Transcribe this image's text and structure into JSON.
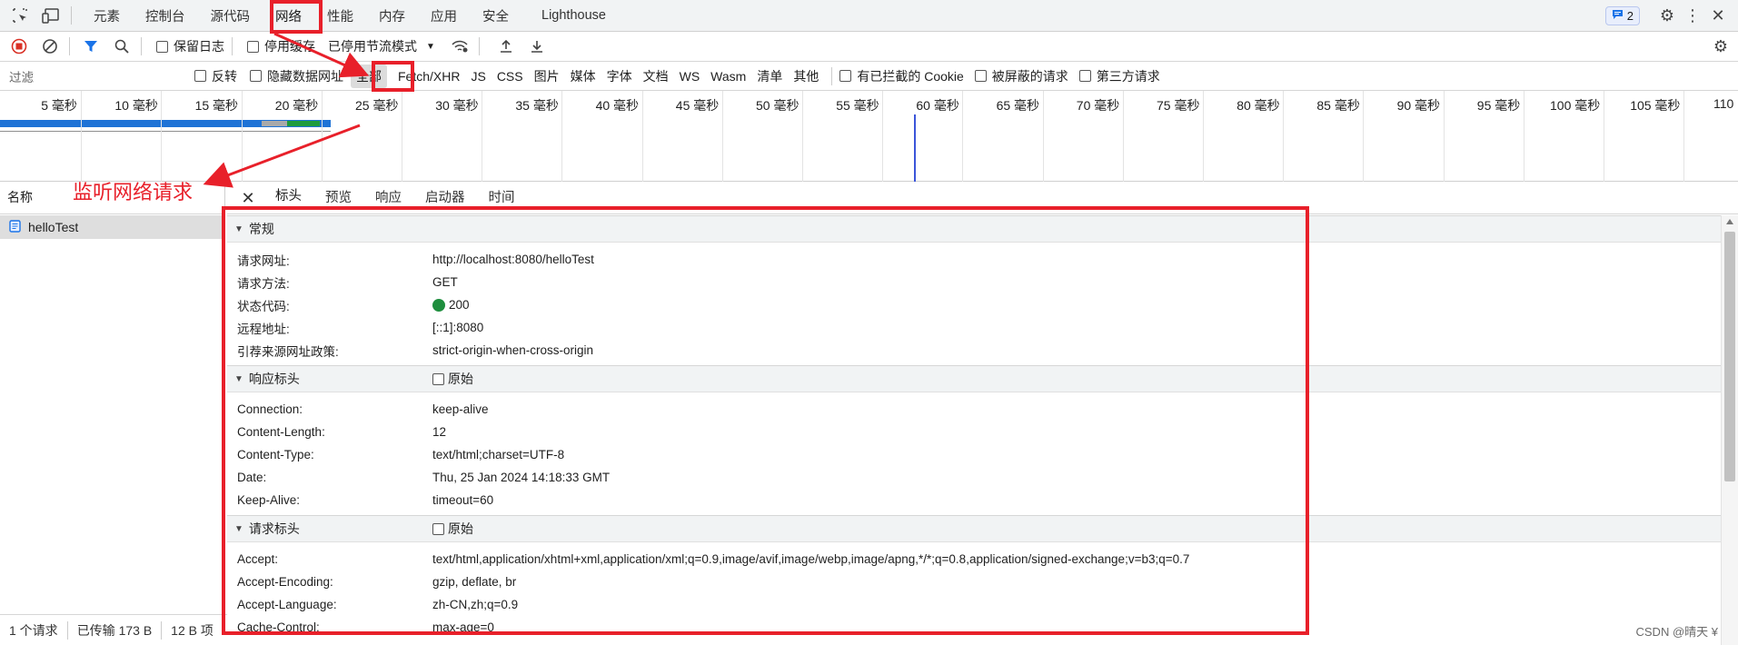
{
  "topbar": {
    "tabs": [
      "元素",
      "控制台",
      "源代码",
      "网络",
      "性能",
      "内存",
      "应用",
      "安全",
      "Lighthouse"
    ],
    "active_tab": "网络",
    "issues_count": "2"
  },
  "toolbar": {
    "preserve_log": "保留日志",
    "disable_cache": "停用缓存",
    "throttle": "已停用节流模式"
  },
  "filter": {
    "placeholder": "过滤",
    "invert": "反转",
    "hide_data_urls": "隐藏数据网址",
    "types": [
      "全部",
      "Fetch/XHR",
      "JS",
      "CSS",
      "图片",
      "媒体",
      "字体",
      "文档",
      "WS",
      "Wasm",
      "清单",
      "其他"
    ],
    "selected_type": "全部",
    "blocked_cookies": "有已拦截的 Cookie",
    "blocked_requests": "被屏蔽的请求",
    "third_party": "第三方请求"
  },
  "timeline": {
    "labels": [
      "5 毫秒",
      "10 毫秒",
      "15 毫秒",
      "20 毫秒",
      "25 毫秒",
      "30 毫秒",
      "35 毫秒",
      "40 毫秒",
      "45 毫秒",
      "50 毫秒",
      "55 毫秒",
      "60 毫秒",
      "65 毫秒",
      "70 毫秒",
      "75 毫秒",
      "80 毫秒",
      "85 毫秒",
      "90 毫秒",
      "95 毫秒",
      "100 毫秒",
      "105 毫秒",
      "110"
    ]
  },
  "list": {
    "header": "名称",
    "items": [
      "helloTest"
    ]
  },
  "status": {
    "requests": "1 个请求",
    "transferred": "已传输 173 B",
    "resources": "12 B 项"
  },
  "details": {
    "tabs": [
      "标头",
      "预览",
      "响应",
      "启动器",
      "时间"
    ],
    "active_tab": "标头",
    "general": {
      "title": "常规",
      "rows": [
        {
          "k": "请求网址:",
          "v": "http://localhost:8080/helloTest"
        },
        {
          "k": "请求方法:",
          "v": "GET"
        },
        {
          "k": "状态代码:",
          "v": "200"
        },
        {
          "k": "远程地址:",
          "v": "[::1]:8080"
        },
        {
          "k": "引荐来源网址政策:",
          "v": "strict-origin-when-cross-origin"
        }
      ]
    },
    "response": {
      "title": "响应标头",
      "raw": "原始",
      "rows": [
        {
          "k": "Connection:",
          "v": "keep-alive"
        },
        {
          "k": "Content-Length:",
          "v": "12"
        },
        {
          "k": "Content-Type:",
          "v": "text/html;charset=UTF-8"
        },
        {
          "k": "Date:",
          "v": "Thu, 25 Jan 2024 14:18:33 GMT"
        },
        {
          "k": "Keep-Alive:",
          "v": "timeout=60"
        }
      ]
    },
    "request": {
      "title": "请求标头",
      "raw": "原始",
      "rows": [
        {
          "k": "Accept:",
          "v": "text/html,application/xhtml+xml,application/xml;q=0.9,image/avif,image/webp,image/apng,*/*;q=0.8,application/signed-exchange;v=b3;q=0.7"
        },
        {
          "k": "Accept-Encoding:",
          "v": "gzip, deflate, br"
        },
        {
          "k": "Accept-Language:",
          "v": "zh-CN,zh;q=0.9"
        },
        {
          "k": "Cache-Control:",
          "v": "max-age=0"
        }
      ]
    }
  },
  "annotation": {
    "label": "监听网络请求",
    "color": "#e8202a"
  },
  "watermark": "CSDN @晴天 ¥"
}
